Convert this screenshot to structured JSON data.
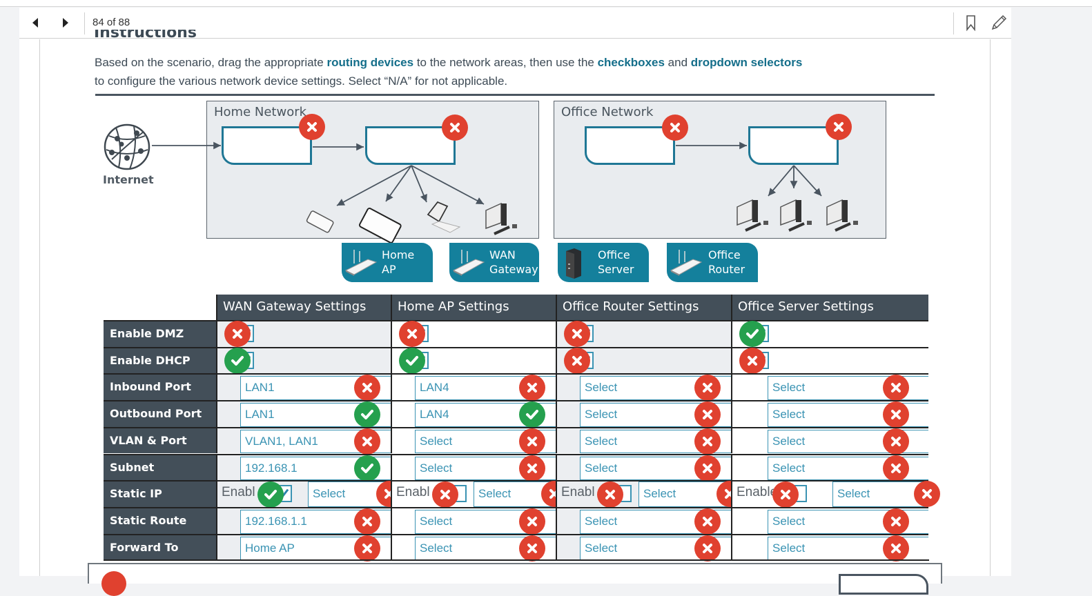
{
  "navbar": {
    "page_indicator": "84 of 88",
    "prev_icon": "triangle-left-icon",
    "next_icon": "triangle-right-icon",
    "bookmark_icon": "bookmark-icon",
    "annotate_icon": "pencil-icon"
  },
  "content": {
    "heading": "Instructions",
    "instructions": {
      "t1": "Based on the scenario, drag the appropriate ",
      "b1": "routing devices",
      "t2": " to the network areas, then use the ",
      "b2": "checkboxes",
      "t3": " and ",
      "b3": "dropdown selectors",
      "t4": " to configure the various network device settings. Select “N/A” for not applicable."
    }
  },
  "diagram": {
    "internet_label": "Internet",
    "areas": [
      {
        "title": "Home Network",
        "slots": [
          {
            "status": "incorrect"
          },
          {
            "status": "incorrect"
          }
        ],
        "endpoints": [
          "phone",
          "tablet",
          "laptop",
          "desktop"
        ]
      },
      {
        "title": "Office Network",
        "slots": [
          {
            "status": "incorrect"
          },
          {
            "status": "incorrect"
          }
        ],
        "endpoints": [
          "desktop",
          "desktop",
          "desktop"
        ]
      }
    ]
  },
  "devices": [
    {
      "line1": "Home",
      "line2": "AP",
      "icon": "router-icon"
    },
    {
      "line1": "WAN",
      "line2": "Gateway",
      "icon": "router-icon"
    },
    {
      "line1": "Office",
      "line2": "Server",
      "icon": "server-icon"
    },
    {
      "line1": "Office",
      "line2": "Router",
      "icon": "router-icon"
    }
  ],
  "colors": {
    "accent": "#14809c",
    "header_bg": "#434f59",
    "incorrect": "#e0412f",
    "correct": "#25a04e",
    "select_text": "#3a93b3"
  },
  "table": {
    "columns": [
      "WAN Gateway Settings",
      "Home AP Settings",
      "Office Router Settings",
      "Office Server Settings"
    ],
    "rows": [
      {
        "label": "Enable DMZ",
        "type": "checkbox",
        "cells": [
          {
            "checked": true,
            "status": "incorrect"
          },
          {
            "checked": true,
            "status": "incorrect"
          },
          {
            "checked": true,
            "status": "incorrect"
          },
          {
            "checked": true,
            "status": "correct"
          }
        ]
      },
      {
        "label": "Enable DHCP",
        "type": "checkbox",
        "cells": [
          {
            "checked": true,
            "status": "correct"
          },
          {
            "checked": true,
            "status": "correct"
          },
          {
            "checked": true,
            "status": "incorrect"
          },
          {
            "checked": true,
            "status": "incorrect"
          }
        ]
      },
      {
        "label": "Inbound Port",
        "type": "select",
        "cells": [
          {
            "value": "LAN1",
            "status": "incorrect"
          },
          {
            "value": "LAN4",
            "status": "incorrect"
          },
          {
            "value": "Select",
            "status": "incorrect"
          },
          {
            "value": "Select",
            "status": "incorrect"
          }
        ]
      },
      {
        "label": "Outbound Port",
        "type": "select",
        "cells": [
          {
            "value": "LAN1",
            "status": "correct"
          },
          {
            "value": "LAN4",
            "status": "correct"
          },
          {
            "value": "Select",
            "status": "incorrect"
          },
          {
            "value": "Select",
            "status": "incorrect"
          }
        ]
      },
      {
        "label": "VLAN & Port",
        "type": "select",
        "cells": [
          {
            "value": "VLAN1, LAN1",
            "status": "incorrect"
          },
          {
            "value": "Select",
            "status": "incorrect"
          },
          {
            "value": "Select",
            "status": "incorrect"
          },
          {
            "value": "Select",
            "status": "incorrect"
          }
        ]
      },
      {
        "label": "Subnet",
        "type": "select",
        "cells": [
          {
            "value": "192.168.1",
            "status": "correct"
          },
          {
            "value": "Select",
            "status": "incorrect"
          },
          {
            "value": "Select",
            "status": "incorrect"
          },
          {
            "value": "Select",
            "status": "incorrect"
          }
        ]
      },
      {
        "label": "Static IP",
        "type": "checkbox-select",
        "enable_label": "Enable",
        "cells": [
          {
            "enable_text": "Enabl",
            "checked": true,
            "check_status": "correct",
            "value": "Select",
            "status": "incorrect"
          },
          {
            "enable_text": "Enabl",
            "checked": false,
            "check_status": "incorrect",
            "value": "Select",
            "status": "incorrect"
          },
          {
            "enable_text": "Enabl",
            "checked": false,
            "check_status": "incorrect",
            "value": "Select",
            "status": "incorrect"
          },
          {
            "enable_text": "Enable",
            "checked": false,
            "check_status": "incorrect",
            "value": "Select",
            "status": "incorrect"
          }
        ]
      },
      {
        "label": "Static Route",
        "type": "select",
        "cells": [
          {
            "value": "192.168.1.1",
            "status": "incorrect"
          },
          {
            "value": "Select",
            "status": "incorrect"
          },
          {
            "value": "Select",
            "status": "incorrect"
          },
          {
            "value": "Select",
            "status": "incorrect"
          }
        ]
      },
      {
        "label": "Forward To",
        "type": "select",
        "cells": [
          {
            "value": "Home AP",
            "status": "incorrect"
          },
          {
            "value": "Select",
            "status": "incorrect"
          },
          {
            "value": "Select",
            "status": "incorrect"
          },
          {
            "value": "Select",
            "status": "incorrect"
          }
        ]
      }
    ]
  }
}
